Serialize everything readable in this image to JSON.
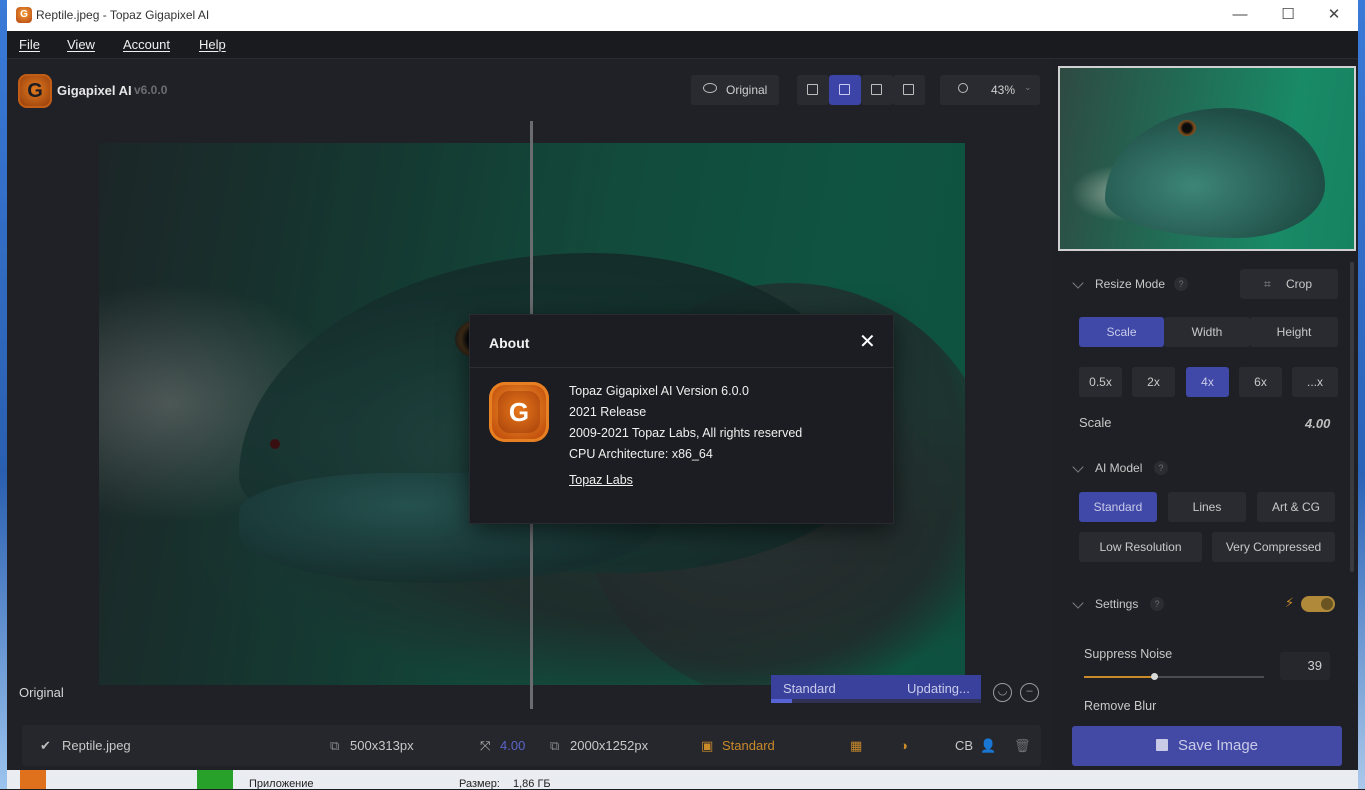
{
  "window": {
    "title": "Reptile.jpeg - Topaz Gigapixel AI",
    "minimize": "—",
    "maximize": "☐",
    "close": "✕"
  },
  "menu": [
    "File",
    "View",
    "Account",
    "Help"
  ],
  "brand": {
    "logo_letter": "G",
    "name": "Gigapixel AI",
    "version": "v6.0.0"
  },
  "toolbar": {
    "original_label": "Original",
    "zoom_value": "43%",
    "active_view": "split"
  },
  "canvas": {
    "original_label": "Original",
    "preview_model": "Standard",
    "preview_status": "Updating...",
    "preview_progress": 0.1
  },
  "infobar": {
    "filename": "Reptile.jpeg",
    "input_size": "500x313px",
    "scale": "4.00",
    "output_size": "2000x1252px",
    "model": "Standard",
    "cb_label": "CB"
  },
  "side": {
    "resize_mode": {
      "title": "Resize Mode",
      "crop_label": "Crop",
      "modes": [
        "Scale",
        "Width",
        "Height"
      ],
      "active_mode": "Scale",
      "scales": [
        "0.5x",
        "2x",
        "4x",
        "6x",
        "...x"
      ],
      "active_scale": "4x",
      "scale_label": "Scale",
      "scale_value": "4.00"
    },
    "ai_model": {
      "title": "AI Model",
      "models_row1": [
        "Standard",
        "Lines",
        "Art & CG"
      ],
      "models_row2": [
        "Low Resolution",
        "Very Compressed"
      ],
      "active": "Standard"
    },
    "settings": {
      "title": "Settings",
      "suppress_noise_label": "Suppress Noise",
      "suppress_noise_value": "39",
      "remove_blur_label": "Remove Blur"
    },
    "save_label": "Save Image"
  },
  "about": {
    "title": "About",
    "logo_letter": "G",
    "line1": "Topaz Gigapixel AI Version 6.0.0",
    "line2": "2021 Release",
    "line3": "2009-2021 Topaz Labs, All rights reserved",
    "line4": "CPU Architecture: x86_64",
    "link": "Topaz Labs",
    "close_glyph": "✕"
  },
  "taskbar": {
    "item1": "Приложение",
    "item2": "Размер:",
    "item3": "1,86 ГБ"
  },
  "colors": {
    "accent": "#4048a8",
    "orange": "#e07a1f",
    "bg": "#1c1d22"
  }
}
